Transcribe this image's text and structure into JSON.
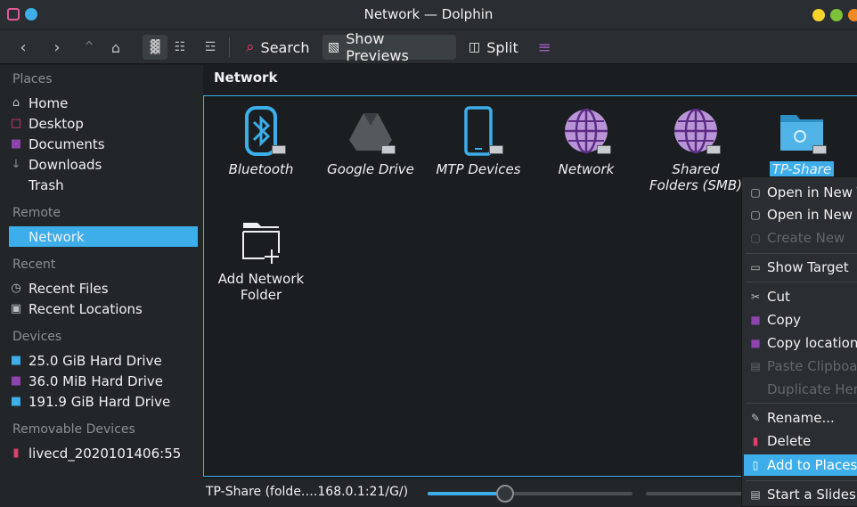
{
  "window": {
    "title": "Network — Dolphin"
  },
  "toolbar": {
    "search_label": "Search",
    "show_previews_label": "Show Previews",
    "split_label": "Split"
  },
  "sidebar": {
    "places_heading": "Places",
    "places": [
      {
        "label": "Home",
        "icon": "home-icon"
      },
      {
        "label": "Desktop",
        "icon": "desktop-icon"
      },
      {
        "label": "Documents",
        "icon": "documents-icon"
      },
      {
        "label": "Downloads",
        "icon": "downloads-icon"
      },
      {
        "label": "Trash",
        "icon": "trash-icon"
      }
    ],
    "remote_heading": "Remote",
    "remote": [
      {
        "label": "Network",
        "icon": "network-icon",
        "selected": true
      }
    ],
    "recent_heading": "Recent",
    "recent": [
      {
        "label": "Recent Files",
        "icon": "clock-icon"
      },
      {
        "label": "Recent Locations",
        "icon": "locations-icon"
      }
    ],
    "devices_heading": "Devices",
    "devices": [
      {
        "label": "25.0 GiB Hard Drive",
        "icon": "hard-drive-icon"
      },
      {
        "label": "36.0 MiB Hard Drive",
        "icon": "hard-drive-icon"
      },
      {
        "label": "191.9 GiB Hard Drive",
        "icon": "hard-drive-icon"
      }
    ],
    "removable_heading": "Removable Devices",
    "removable": [
      {
        "label": "livecd_2020101406:55",
        "icon": "optical-disc-icon"
      }
    ]
  },
  "breadcrumb": {
    "current": "Network"
  },
  "items": [
    {
      "label": "Bluetooth",
      "icon": "bluetooth-icon"
    },
    {
      "label": "Google Drive",
      "icon": "google-drive-icon"
    },
    {
      "label": "MTP Devices",
      "icon": "phone-icon"
    },
    {
      "label": "Network",
      "icon": "globe-icon"
    },
    {
      "label": "Shared Folders (SMB)",
      "label_line1": "Shared",
      "label_line2": "Folders (SMB)",
      "icon": "globe-icon"
    },
    {
      "label": "TP-Share",
      "icon": "network-folder-icon",
      "selected": true
    },
    {
      "label": "Add Network Folder",
      "label_line1": "Add Network",
      "label_line2": "Folder",
      "icon": "add-folder-icon"
    }
  ],
  "status": {
    "text": "TP-Share (folde….168.0.1:21/G/)",
    "zoom": 0.38
  },
  "context_menu": {
    "items": [
      {
        "label": "Open in New T",
        "icon": "open-tab-icon",
        "enabled": true
      },
      {
        "label": "Open in New W",
        "icon": "open-window-icon",
        "enabled": true
      },
      {
        "label": "Create New",
        "icon": "create-new-icon",
        "enabled": false
      },
      {
        "label": "Show Target",
        "icon": "show-target-icon",
        "enabled": true
      },
      {
        "label": "Cut",
        "icon": "cut-icon",
        "enabled": true
      },
      {
        "label": "Copy",
        "icon": "copy-icon",
        "enabled": true
      },
      {
        "label": "Copy location",
        "icon": "copy-location-icon",
        "enabled": true
      },
      {
        "label": "Paste Clipboa",
        "icon": "paste-icon",
        "enabled": false
      },
      {
        "label": "Duplicate Her",
        "icon": "duplicate-icon",
        "enabled": false
      },
      {
        "label": "Rename...",
        "icon": "rename-icon",
        "enabled": true
      },
      {
        "label": "Delete",
        "icon": "delete-icon",
        "enabled": true
      },
      {
        "label": "Add to Places",
        "icon": "add-places-icon",
        "enabled": true,
        "highlighted": true
      },
      {
        "label": "Start a Slidesh",
        "icon": "slideshow-icon",
        "enabled": true
      }
    ]
  },
  "colors": {
    "accent": "#3daee9",
    "window_bg": "#1b1e20",
    "panel_bg": "#232629",
    "toolbar_bg": "#2a2e32"
  }
}
